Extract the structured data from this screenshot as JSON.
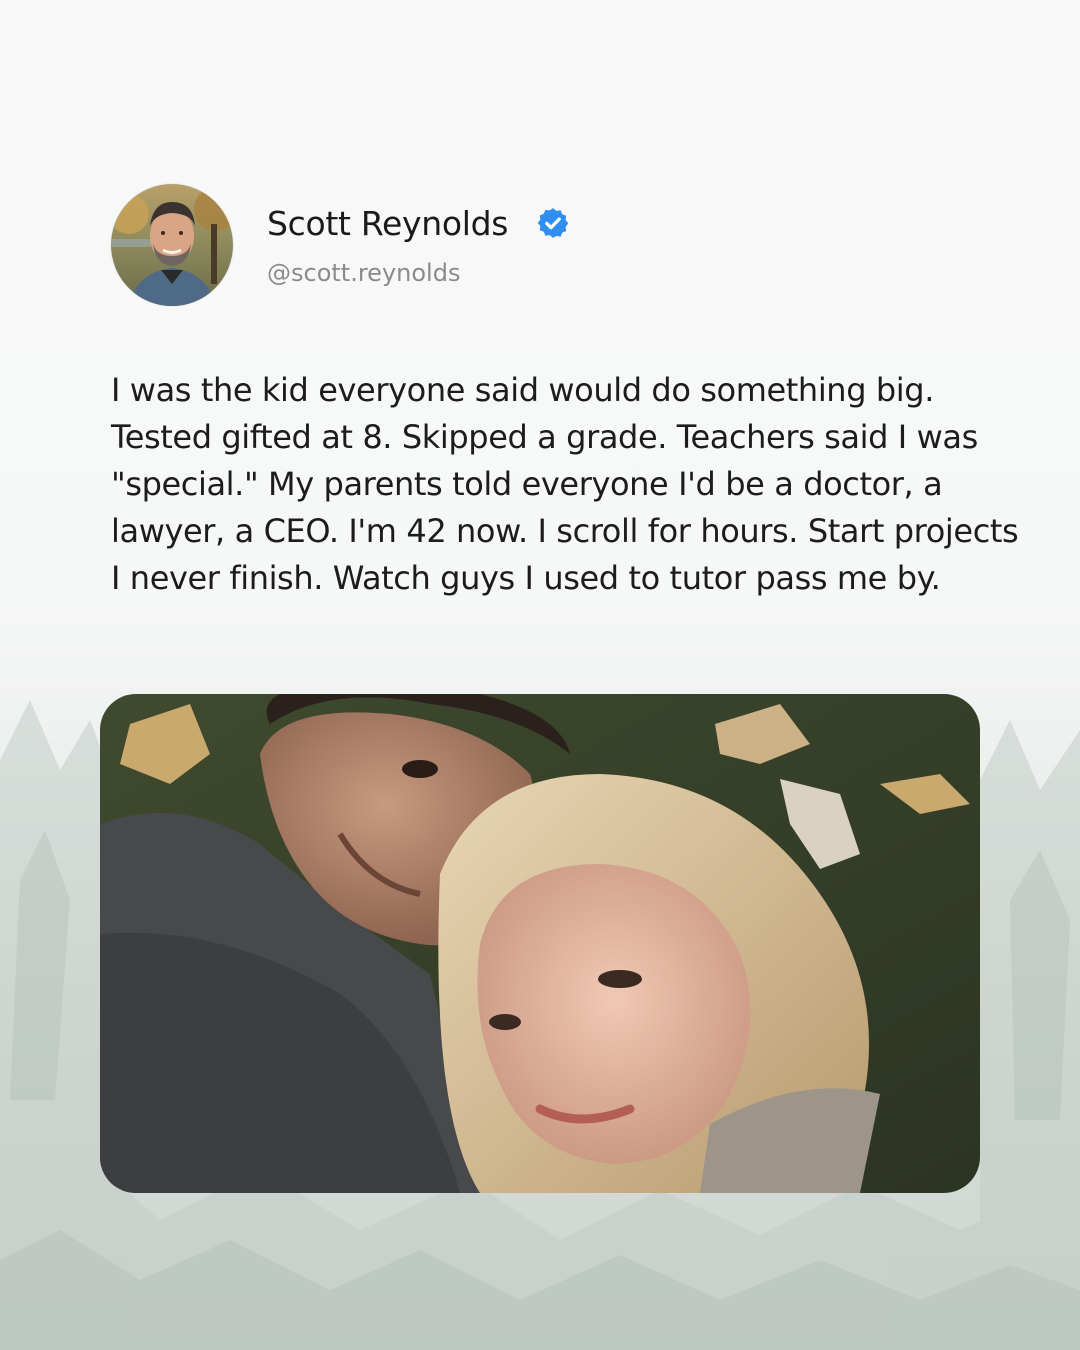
{
  "post": {
    "author": {
      "display_name": "Scott Reynolds",
      "handle": "@scott.reynolds",
      "verified": true
    },
    "text": "I was the kid everyone said would do something big. Tested gifted at 8. Skipped a grade. Teachers said I was \"special.\" My parents told everyone I'd be a doctor, a lawyer, a CEO. I'm 42 now. I scroll for hours. Start projects I never finish. Watch guys I used to tutor pass me by."
  },
  "colors": {
    "verified_badge": "#2f8ef0",
    "name_text": "#1a1a1a",
    "handle_text": "#8b8b8b",
    "body_text": "#1c1c1c"
  },
  "icons": {
    "verified": "verified-badge-icon"
  }
}
